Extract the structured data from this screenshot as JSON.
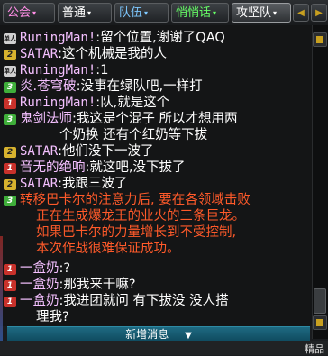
{
  "colors": {
    "tab_label": "#ff8ee6",
    "tab_label_team": "#7ec8ff",
    "tab_label_quiet": "#66ff66",
    "tab_label_white": "#ffffff",
    "player_name": "#f4c0ff",
    "message": "#ffffff",
    "raid_warning": "#ff5a2a",
    "new_message_bar": "#1e6a82",
    "badge_yellow": "#d7b22e",
    "badge_green": "#3fae3a",
    "badge_red": "#c8312b",
    "badge_gray": "#d0d0d0"
  },
  "tabs": [
    {
      "label": "公会",
      "arrow": "▾",
      "color": "#ff8ee6"
    },
    {
      "label": "普通",
      "arrow": "▾",
      "color": "#ffffff"
    },
    {
      "label": "队伍",
      "arrow": "▾",
      "color": "#7ec8ff"
    },
    {
      "label": "悄悄话",
      "arrow": "▾",
      "color": "#66ff66"
    },
    {
      "label": "攻坚队",
      "arrow": "▾",
      "color": "#ffffff"
    }
  ],
  "nav": {
    "prev_icon": "◀",
    "next_icon": "▶"
  },
  "messages": [
    {
      "badge": "单人",
      "badge_type": "gray",
      "name": "RuningMan!",
      "sep": ":",
      "text": "留个位置,谢谢了QAQ"
    },
    {
      "badge": "2",
      "badge_type": "yellow",
      "name": "SATAR",
      "sep": ":",
      "text": "这个机械是我的人"
    },
    {
      "badge": "单人",
      "badge_type": "gray",
      "name": "RuningMan!",
      "sep": ":",
      "text": "1"
    },
    {
      "badge": "3",
      "badge_type": "green",
      "name": "炎.苍穹破",
      "sep": ":",
      "text": "没事在绿队吧,一样打"
    },
    {
      "badge": "1",
      "badge_type": "red",
      "name": "RuningMan!",
      "sep": ":",
      "text": "队,就是这个"
    },
    {
      "badge": "3",
      "badge_type": "green",
      "name": "鬼剑法师",
      "sep": ":",
      "text": "我这是个混子  所以才想用两",
      "cont": "个奶换  还有个红奶等下拔"
    },
    {
      "badge": "2",
      "badge_type": "yellow",
      "name": "SATAR",
      "sep": ":",
      "text": "他们没下一波了"
    },
    {
      "badge": "1",
      "badge_type": "red",
      "name": "音无的绝响",
      "sep": ":",
      "text": "就这吧,没下拔了"
    },
    {
      "badge": "2",
      "badge_type": "yellow",
      "name": "SATAR",
      "sep": ":",
      "text": "我跟三波了"
    }
  ],
  "raid_notice": {
    "badge": "3",
    "badge_type": "green",
    "lines": [
      "转移巴卡尔的注意力后, 要在各领域击败",
      "正在生成爆龙王的业火的三条巨龙。",
      "如果巴卡尔的力量增长到不受控制,",
      "本次作战很难保证成功。"
    ]
  },
  "messages_after": [
    {
      "badge": "1",
      "badge_type": "red",
      "name": "一盒奶",
      "sep": ":",
      "text": "?"
    },
    {
      "badge": "1",
      "badge_type": "red",
      "name": "一盒奶",
      "sep": ":",
      "text": "那我来干嘛?"
    },
    {
      "badge": "1",
      "badge_type": "red",
      "name": "一盒奶",
      "sep": ":",
      "text": "我进团就问  有下拔没  没人搭",
      "cont": "理我?"
    }
  ],
  "new_message_bar": {
    "label": "新增消息",
    "arrow": "▼"
  },
  "corner_label": "精品"
}
